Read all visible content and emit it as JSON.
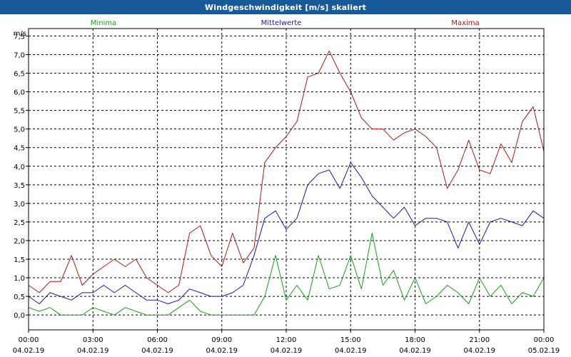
{
  "window": {
    "title": "Windgeschwindigkeit [m/s] skaliert"
  },
  "colors": {
    "background": "#ffffff",
    "titlebar": "#165a9a",
    "axis": "#000000",
    "grid": "#000000"
  },
  "chart_data": {
    "type": "line",
    "title": "Windgeschwindigkeit [m/s] skaliert",
    "ylabel": "m/s",
    "ylim": [
      -0.4,
      7.7
    ],
    "xlim": [
      0,
      24
    ],
    "grid": true,
    "yticks": [
      "0,0",
      "0,5",
      "1,0",
      "1,5",
      "2,0",
      "2,5",
      "3,0",
      "3,5",
      "4,0",
      "4,5",
      "5,0",
      "5,5",
      "6,0",
      "6,5",
      "7,0",
      "7,5"
    ],
    "ytick_values": [
      0,
      0.5,
      1,
      1.5,
      2,
      2.5,
      3,
      3.5,
      4,
      4.5,
      5,
      5.5,
      6,
      6.5,
      7,
      7.5
    ],
    "xticks": [
      {
        "h": 0,
        "time": "00:00",
        "date": "04.02.19"
      },
      {
        "h": 3,
        "time": "03:00",
        "date": "04.02.19"
      },
      {
        "h": 6,
        "time": "06:00",
        "date": "04.02.19"
      },
      {
        "h": 9,
        "time": "09:00",
        "date": "04.02.19"
      },
      {
        "h": 12,
        "time": "12:00",
        "date": "04.02.19"
      },
      {
        "h": 15,
        "time": "15:00",
        "date": "04.02.19"
      },
      {
        "h": 18,
        "time": "18:00",
        "date": "04.02.19"
      },
      {
        "h": 21,
        "time": "21:00",
        "date": "04.02.19"
      },
      {
        "h": 24,
        "time": "00:00",
        "date": "05.02.19"
      }
    ],
    "x_unit": "hour of day",
    "series": [
      {
        "name": "Minima",
        "color": "#1aa01a",
        "x": [
          0,
          0.5,
          1,
          1.5,
          2,
          2.5,
          3,
          3.5,
          4,
          4.5,
          5,
          5.5,
          6,
          6.5,
          7,
          7.5,
          8,
          8.5,
          9,
          9.5,
          10,
          10.5,
          11,
          11.5,
          12,
          12.5,
          13,
          13.5,
          14,
          14.5,
          15,
          15.5,
          16,
          16.5,
          17,
          17.5,
          18,
          18.5,
          19,
          19.5,
          20,
          20.5,
          21,
          21.5,
          22,
          22.5,
          23,
          23.5,
          24
        ],
        "values": [
          0.2,
          0.1,
          0.2,
          0,
          0,
          0,
          0.2,
          0.1,
          0,
          0.2,
          0.1,
          0,
          0,
          0,
          0.2,
          0.4,
          0.1,
          0,
          0,
          0,
          0,
          0,
          0.5,
          1.6,
          0.4,
          0.8,
          0.4,
          1.6,
          0.7,
          0.8,
          1.6,
          0.7,
          2.2,
          0.8,
          1.2,
          0.4,
          1.0,
          0.3,
          0.5,
          0.8,
          0.6,
          0.3,
          1.0,
          0.5,
          0.8,
          0.3,
          0.6,
          0.5,
          1.0
        ]
      },
      {
        "name": "Mittelwerte",
        "color": "#1a1aaa",
        "x": [
          0,
          0.5,
          1,
          1.5,
          2,
          2.5,
          3,
          3.5,
          4,
          4.5,
          5,
          5.5,
          6,
          6.5,
          7,
          7.5,
          8,
          8.5,
          9,
          9.5,
          10,
          10.5,
          11,
          11.5,
          12,
          12.5,
          13,
          13.5,
          14,
          14.5,
          15,
          15.5,
          16,
          16.5,
          17,
          17.5,
          18,
          18.5,
          19,
          19.5,
          20,
          20.5,
          21,
          21.5,
          22,
          22.5,
          23,
          23.5,
          24
        ],
        "values": [
          0.5,
          0.3,
          0.6,
          0.5,
          0.4,
          0.6,
          0.6,
          0.8,
          0.6,
          0.8,
          0.6,
          0.4,
          0.4,
          0.3,
          0.4,
          0.7,
          0.6,
          0.5,
          0.5,
          0.6,
          0.8,
          1.6,
          2.6,
          2.8,
          2.3,
          2.6,
          3.5,
          3.8,
          3.9,
          3.4,
          4.1,
          3.7,
          3.2,
          2.9,
          2.6,
          2.9,
          2.4,
          2.6,
          2.6,
          2.5,
          1.8,
          2.5,
          1.9,
          2.5,
          2.6,
          2.5,
          2.4,
          2.8,
          2.6
        ]
      },
      {
        "name": "Maxima",
        "color": "#aa1a1a",
        "x": [
          0,
          0.5,
          1,
          1.5,
          2,
          2.5,
          3,
          3.5,
          4,
          4.5,
          5,
          5.5,
          6,
          6.5,
          7,
          7.5,
          8,
          8.5,
          9,
          9.5,
          10,
          10.5,
          11,
          11.5,
          12,
          12.5,
          13,
          13.5,
          14,
          14.5,
          15,
          15.5,
          16,
          16.5,
          17,
          17.5,
          18,
          18.5,
          19,
          19.5,
          20,
          20.5,
          21,
          21.5,
          22,
          22.5,
          23,
          23.5,
          24
        ],
        "values": [
          0.8,
          0.6,
          0.9,
          0.9,
          1.6,
          0.8,
          1.1,
          1.3,
          1.5,
          1.3,
          1.5,
          1.0,
          0.8,
          0.6,
          0.8,
          2.2,
          2.4,
          1.6,
          1.3,
          2.2,
          1.4,
          1.8,
          4.1,
          4.5,
          4.8,
          5.2,
          6.4,
          6.5,
          7.1,
          6.5,
          6.0,
          5.3,
          5.0,
          5.0,
          4.7,
          4.9,
          5.0,
          4.8,
          4.5,
          3.4,
          3.9,
          4.7,
          3.9,
          3.8,
          4.6,
          4.1,
          5.2,
          5.6,
          4.4
        ]
      }
    ]
  }
}
